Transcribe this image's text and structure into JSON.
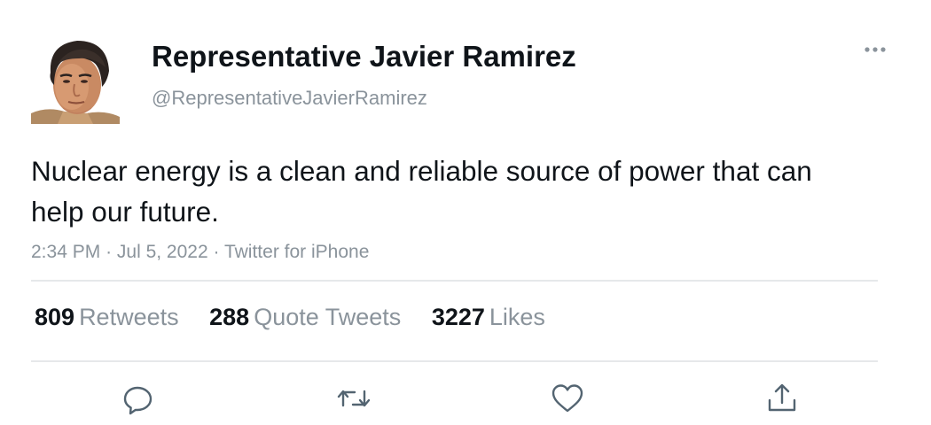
{
  "tweet": {
    "display_name": "Representative Javier Ramirez",
    "handle": "@RepresentativeJavierRamirez",
    "text": "Nuclear energy is a clean and reliable source of power that can help our future.",
    "time": "2:34 PM",
    "date": "Jul 5, 2022",
    "source": "Twitter for iPhone",
    "separator": "·"
  },
  "stats": {
    "retweets_count": "809",
    "retweets_label": "Retweets",
    "quotes_count": "288",
    "quotes_label": "Quote Tweets",
    "likes_count": "3227",
    "likes_label": "Likes"
  },
  "icons": {
    "more": "more-horizontal-icon",
    "reply": "reply-icon",
    "retweet": "retweet-icon",
    "like": "heart-icon",
    "share": "share-icon"
  },
  "colors": {
    "text": "#0f1419",
    "secondary": "#8a939b",
    "divider": "#e6e8ea",
    "icon": "#536471"
  }
}
